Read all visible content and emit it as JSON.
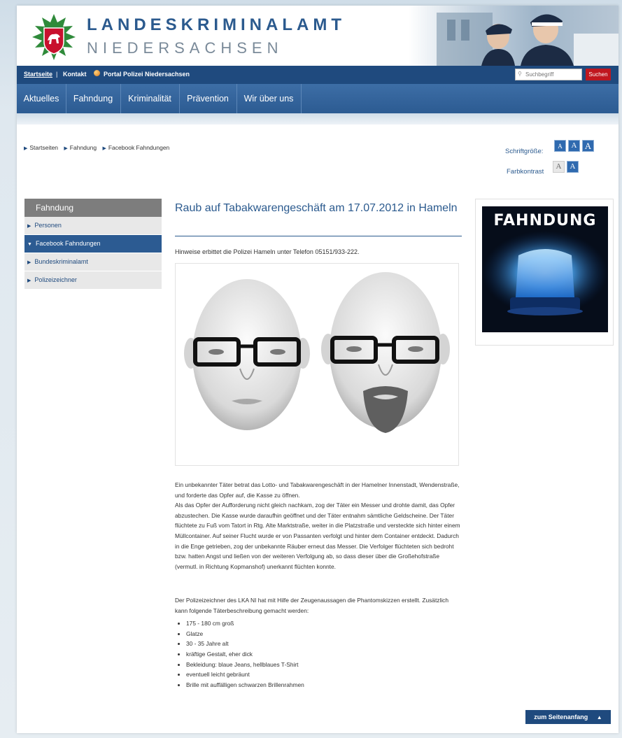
{
  "header": {
    "title_line1": "LANDESKRIMINALAMT",
    "title_line2": "NIEDERSACHSEN"
  },
  "topbar": {
    "startseite": "Startseite",
    "divider": "|",
    "kontakt": "Kontakt",
    "portal": "Portal Polizei Niedersachsen",
    "search_placeholder": "Suchbegriff",
    "search_button": "Suchen"
  },
  "mainnav": [
    "Aktuelles",
    "Fahndung",
    "Kriminalität",
    "Prävention",
    "Wir über uns"
  ],
  "breadcrumb": [
    "Startseiten",
    "Fahndung",
    "Facebook Fahndungen"
  ],
  "accessibility": {
    "fontsize_label": "Schriftgröße:",
    "contrast_label": "Farbkontrast",
    "letter": "A"
  },
  "sidebar": {
    "head": "Fahndung",
    "items": [
      "Personen",
      "Facebook Fahndungen",
      "Bundeskriminalamt",
      "Polizeizeichner"
    ]
  },
  "article": {
    "heading": "Raub auf Tabakwarengeschäft am 17.07.2012 in Hameln",
    "intro": "Hinweise erbittet die Polizei Hameln unter Telefon 05151/933-222.",
    "para1": "Ein unbekannter Täter betrat das Lotto- und Tabakwarengeschäft in der Hamelner Innenstadt, Wendenstraße, und forderte das Opfer auf, die Kasse zu öffnen.",
    "para2": "Als das Opfer der Aufforderung nicht gleich nachkam, zog der Täter ein Messer und drohte damit, das Opfer abzustechen. Die Kasse wurde daraufhin geöffnet und der Täter entnahm sämtliche Geldscheine. Der Täter flüchtete zu Fuß vom Tatort in Rtg. Alte Marktstraße, weiter in die Platzstraße und versteckte sich hinter einem Müllcontainer. Auf seiner Flucht wurde er von Passanten verfolgt und hinter dem Container entdeckt. Dadurch in die Enge getrieben, zog der unbekannte Räuber erneut das Messer. Die Verfolger flüchteten sich bedroht bzw. hatten Angst und ließen von der weiteren Verfolgung ab, so dass dieser über die Großehofstraße (vermutl. in Richtung Kopmanshof) unerkannt flüchten konnte.",
    "para3": "Der Polizeizeichner des LKA NI hat mit Hilfe der Zeugenaussagen die Phantomskizzen erstellt. Zusätzlich kann folgende Täterbeschreibung gemacht werden:",
    "details": [
      "175 - 180 cm groß",
      "Glatze",
      "30 - 35 Jahre alt",
      "kräftige Gestalt, eher dick",
      "Bekleidung: blaue Jeans, hellblaues T-Shirt",
      "eventuell leicht gebräunt",
      "Brille mit auffälligen schwarzen Brillenrahmen"
    ]
  },
  "teaser": {
    "title": "FAHNDUNG"
  },
  "footer": {
    "to_top": "zum Seitenanfang"
  },
  "colors": {
    "brand_blue": "#2c5b92",
    "nav_blue": "#1f4a7e",
    "search_red": "#c0171f"
  }
}
